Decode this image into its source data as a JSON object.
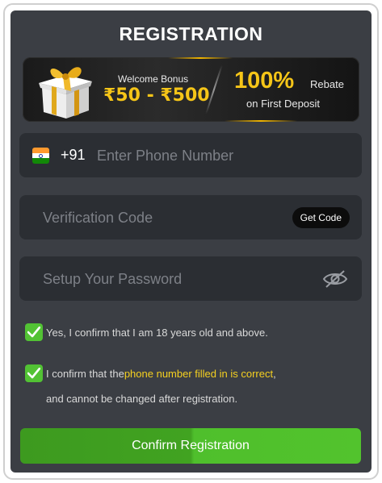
{
  "header": {
    "title": "REGISTRATION"
  },
  "banner": {
    "bonus_label": "Welcome Bonus",
    "bonus_amount": "₹50 - ₹500",
    "rebate_percent": "100%",
    "rebate_word": "Rebate",
    "rebate_sub": "on First Deposit",
    "icon": "gift-box-icon"
  },
  "form": {
    "phone": {
      "country_icon": "india-flag-icon",
      "prefix": "+91",
      "placeholder": "Enter Phone Number",
      "value": ""
    },
    "code": {
      "placeholder": "Verification Code",
      "value": "",
      "button_label": "Get Code"
    },
    "password": {
      "placeholder": "Setup Your Password",
      "value": "",
      "toggle_icon": "eye-slash-icon"
    }
  },
  "agreements": {
    "age": {
      "checked": true,
      "text": "Yes, I confirm that I am 18 years old and above."
    },
    "phone_confirm": {
      "checked": true,
      "text_before": "I confirm that the",
      "highlight": "phone number filled in is correct",
      "text_after": ",",
      "line2": "and cannot be changed after registration."
    }
  },
  "actions": {
    "confirm_label": "Confirm Registration"
  },
  "colors": {
    "panel_bg": "#3b3e44",
    "field_bg": "#2b2e33",
    "accent_gold": "#f5c518",
    "accent_green": "#52c234",
    "highlight_yellow": "#f5d020"
  }
}
